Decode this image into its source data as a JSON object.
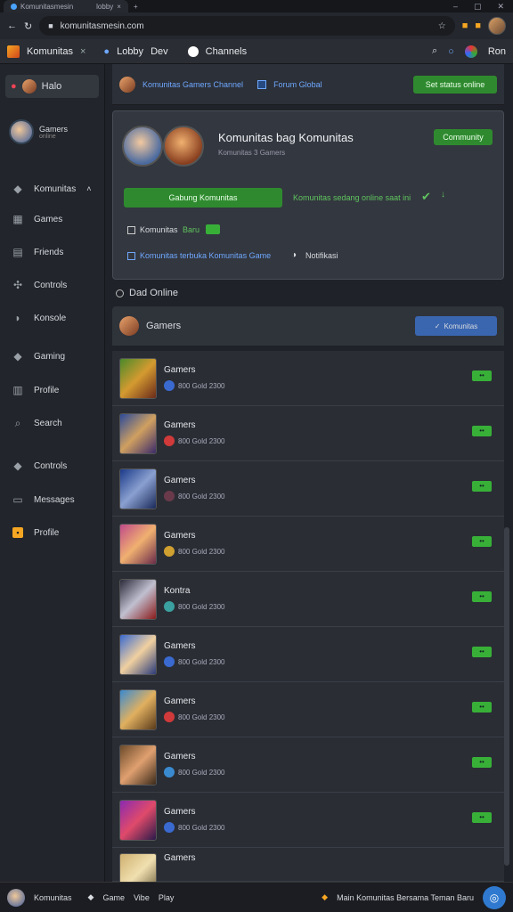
{
  "browser": {
    "tab_title": "Komunitasmesin",
    "tab2_title": "lobby",
    "url": "komunitasmesin.com"
  },
  "appbar": {
    "app_name": "Komunitas",
    "lobby_label": "Lobby",
    "dev_label": "Dev",
    "channels_label": "Channels",
    "user_label": "Ron"
  },
  "sidebar": {
    "home_label": "Halo",
    "profile_name": "Gamers",
    "profile_sub": "online",
    "komunitas_label": "Komunitas",
    "items": [
      {
        "label": "Games",
        "icon": "grid-icon"
      },
      {
        "label": "Friends",
        "icon": "users-icon"
      },
      {
        "label": "Controls",
        "icon": "gamepad-icon"
      },
      {
        "label": "Konsole",
        "icon": "joystick-icon"
      },
      {
        "label": "Gaming",
        "icon": "pad-icon"
      },
      {
        "label": "Profile",
        "icon": "bars-icon"
      },
      {
        "label": "Search",
        "icon": "search-icon"
      },
      {
        "label": "Controls",
        "icon": "controller-icon"
      },
      {
        "label": "Messages",
        "icon": "mail-icon"
      },
      {
        "label": "Profile",
        "icon": "star-icon"
      }
    ]
  },
  "banner": {
    "text": "Komunitas Gamers Channel",
    "check_label": "Forum Global",
    "button_label": "Set status online"
  },
  "community": {
    "title": "Komunitas bag Komunitas",
    "subtitle": "Komunitas 3 Gamers",
    "join_label": "Gabung Komunitas",
    "status_text": "Komunitas sedang online saat ini",
    "community_button": "Community",
    "check_row_label": "Komunitas",
    "check_row_tag": "Baru",
    "link_text": "Komunitas terbuka Komunitas Game",
    "notif_label": "Notifikasi"
  },
  "online": {
    "label": "Dad Online"
  },
  "list": {
    "header_name": "Gamers",
    "header_button": "Komunitas",
    "rows": [
      {
        "name": "Gamers",
        "sub": "800 Gold 2300"
      },
      {
        "name": "Gamers",
        "sub": "800 Gold 2300"
      },
      {
        "name": "Gamers",
        "sub": "800 Gold 2300"
      },
      {
        "name": "Gamers",
        "sub": "800 Gold 2300"
      },
      {
        "name": "Kontra",
        "sub": "800 Gold 2300"
      },
      {
        "name": "Gamers",
        "sub": "800 Gold 2300"
      },
      {
        "name": "Gamers",
        "sub": "800 Gold 2300"
      },
      {
        "name": "Gamers",
        "sub": "800 Gold 2300"
      },
      {
        "name": "Gamers",
        "sub": "800 Gold 2300"
      },
      {
        "name": "Gamers",
        "sub": ""
      }
    ],
    "tag_label": "••"
  },
  "bottombar": {
    "user": "Komunitas",
    "a": "Game",
    "b": "Vibe",
    "c": "Play",
    "right_text": "Main Komunitas Bersama Teman Baru"
  },
  "colors": {
    "accent_green": "#2f8a2f",
    "accent_blue": "#3a66b0",
    "bg": "#1f2228"
  }
}
